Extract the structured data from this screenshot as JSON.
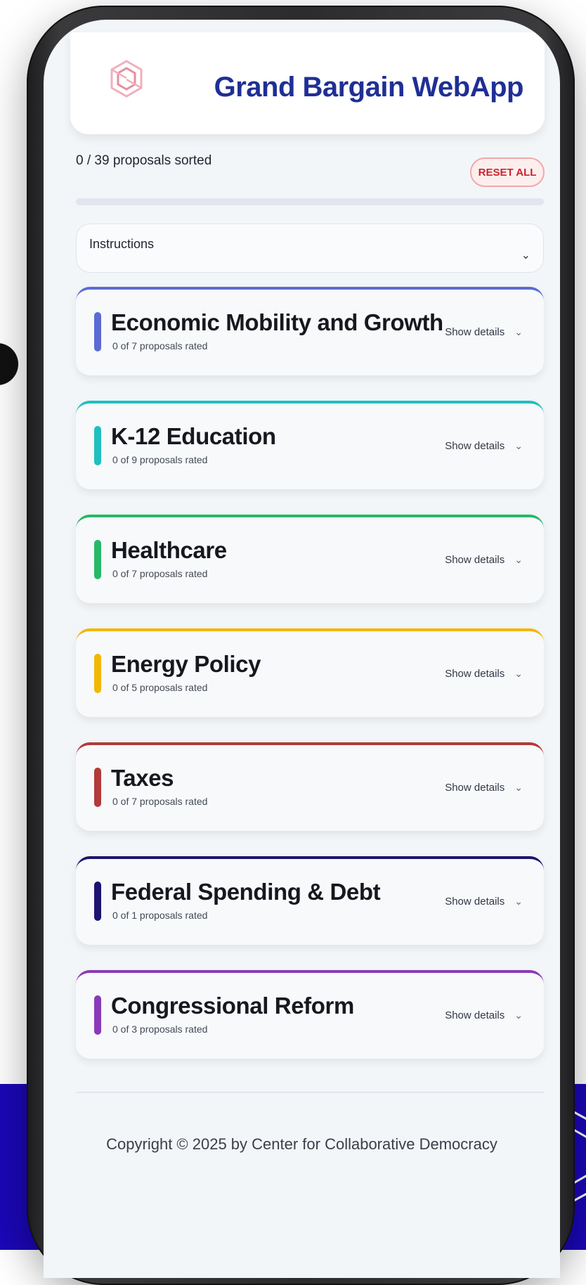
{
  "header": {
    "app_title": "Grand Bargain WebApp",
    "logo_icon": "hexagon-knot-logo-icon"
  },
  "progress": {
    "sorted_text": "0 / 39 proposals sorted",
    "sorted": 0,
    "total": 39,
    "reset_label": "RESET ALL"
  },
  "instructions": {
    "label": "Instructions",
    "chevron_icon": "chevron-down-icon"
  },
  "categories": [
    {
      "title": "Economic Mobility and Growth",
      "subtitle": "0 of 7 proposals rated",
      "details_label": "Show details",
      "accent": "#5b6bd4"
    },
    {
      "title": "K-12 Education",
      "subtitle": "0 of 9 proposals rated",
      "details_label": "Show details",
      "accent": "#1fbfbf"
    },
    {
      "title": "Healthcare",
      "subtitle": "0 of 7 proposals rated",
      "details_label": "Show details",
      "accent": "#27b86a"
    },
    {
      "title": "Energy Policy",
      "subtitle": "0 of 5 proposals rated",
      "details_label": "Show details",
      "accent": "#f2b705"
    },
    {
      "title": "Taxes",
      "subtitle": "0 of 7 proposals rated",
      "details_label": "Show details",
      "accent": "#b23a3a"
    },
    {
      "title": "Federal Spending & Debt",
      "subtitle": "0 of 1 proposals rated",
      "details_label": "Show details",
      "accent": "#1c1470"
    },
    {
      "title": "Congressional Reform",
      "subtitle": "0 of 3 proposals rated",
      "details_label": "Show details",
      "accent": "#8a3ab8"
    }
  ],
  "footer": {
    "copyright": "Copyright © 2025 by Center for Collaborative Democracy"
  },
  "colors": {
    "brand_blue": "#1f2f95",
    "reset_red": "#c8262d",
    "backdrop_blue": "#1b07b8"
  }
}
